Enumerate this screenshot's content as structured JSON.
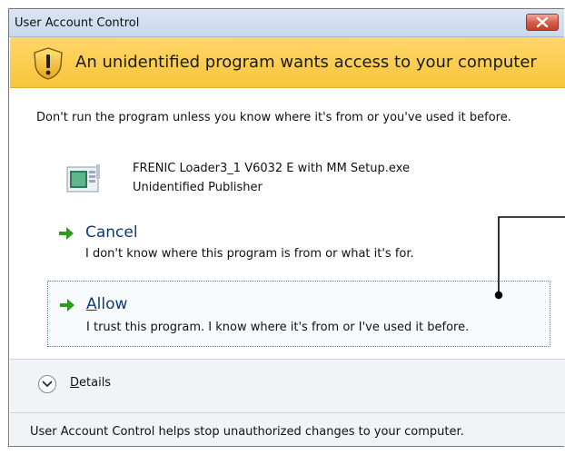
{
  "window": {
    "title": "User Account Control"
  },
  "banner": {
    "message": "An unidentified program wants access to your computer"
  },
  "warning_text": "Don't run the program unless you know where it's from or you've used it before.",
  "program": {
    "name": "FRENIC Loader3_1 V6032 E with MM Setup.exe",
    "publisher": "Unidentified Publisher",
    "icon": "installer-icon"
  },
  "options": {
    "cancel": {
      "title": "Cancel",
      "description": "I don't know where this program is from or what it's for."
    },
    "allow": {
      "title_underlined": "A",
      "title_rest": "llow",
      "description": "I trust this program. I know where it's from or I've used it before."
    }
  },
  "details": {
    "label_underlined": "D",
    "label_rest": "etails"
  },
  "footer": {
    "text": "User Account Control helps stop unauthorized changes to your computer."
  },
  "colors": {
    "banner": "#f8c53a",
    "arrow": "#2e9a1f",
    "option_title": "#0f3a7a",
    "close_button": "#d35a45"
  }
}
